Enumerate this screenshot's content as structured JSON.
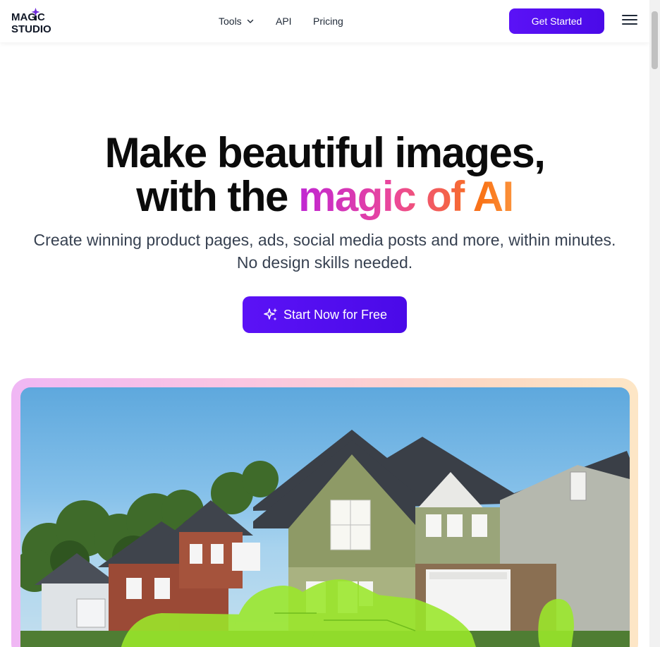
{
  "header": {
    "logo_text": "MAGIC STUDIO",
    "nav": [
      {
        "label": "Tools",
        "has_dropdown": true
      },
      {
        "label": "API"
      },
      {
        "label": "Pricing"
      }
    ],
    "cta_label": "Get Started",
    "menu_icon": "hamburger-menu-icon"
  },
  "hero": {
    "title_line1": "Make beautiful images,",
    "title_line2_plain": "with the ",
    "title_line2_gradient": "magic of AI",
    "subtitle": "Create winning product pages, ads, social media posts and more, within minutes. No design skills needed.",
    "cta_label": "Start Now for Free",
    "cta_icon": "sparkles-icon"
  },
  "showcase": {
    "image": "suburban-houses-photo-with-green-highlighted-cars"
  },
  "colors": {
    "brand": "#5b12f6",
    "gradient_start": "#c026d3",
    "gradient_mid": "#ec4899",
    "gradient_end": "#fb923c",
    "highlight_green": "#9be82a"
  }
}
